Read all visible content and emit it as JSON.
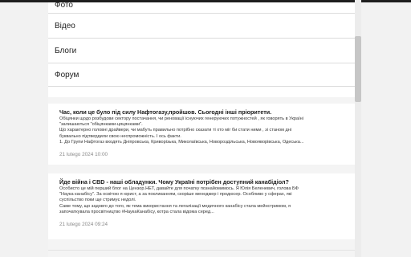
{
  "menu": {
    "items": [
      {
        "label": "Фото"
      },
      {
        "label": "Відео"
      },
      {
        "label": "Блоги"
      },
      {
        "label": "Форум"
      }
    ]
  },
  "feed": {
    "cards": [
      {
        "title": "Час, коли це було під силу Нафтогазу,пройшов. Сьогодні інші пріоритети.",
        "lines": [
          "Обіцянки щодо розбудови сектору постачання, чи реновації існуючих генеруючих потужностей , як говорять в Україні",
          "\"залишаються \"обіцянками-цяцянками\".",
          "Що характерно головні драйвери, чи мабуть правильно потрібно сказати ті хто міг би стати ними , зі станом дні",
          "буквально підтвердили свою неспроможність. І ось факти.",
          "1. До Групи Нафтогаз входять Дніпровська, Криворізька, Миколаївська, Новороздільська, Новояворівська, Одеська..."
        ],
        "date": "21 lutego 2024 10:00"
      },
      {
        "title": "Йде війна і CBD - наші обладунки. Чому Україні потрібен доступний канабідіол?",
        "lines": [
          "Особисто це мій перший блог на Цензор.НЕТ, давайте для початку познайомимось. Я Юлія Беленевич, голова БФ",
          "\"Наука канабісу\". За освітою я юрист, а за покликанням, скоріше менеджер і продюсер. Особливо у сферах, які",
          "суспільство поки ще стримує недолі.",
          "Саме тому, що задовго до того, як тема використання та легалізації медичного канабісу стала мейнстримом, я",
          "започаткувала просвітництво #НаукаКанабісу, котра стала відома серед..."
        ],
        "date": "21 lutego 2024 09:24"
      }
    ]
  }
}
